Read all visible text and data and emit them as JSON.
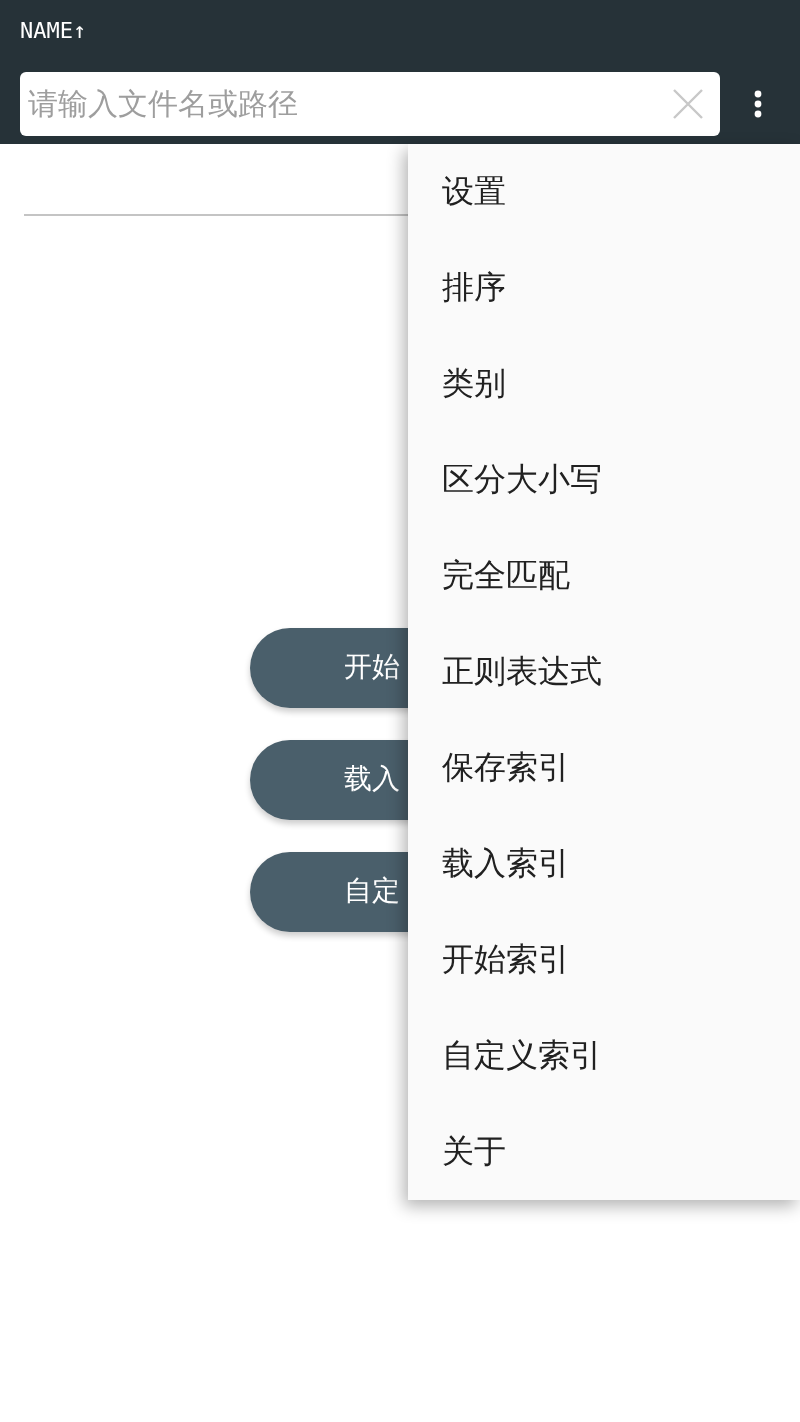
{
  "header": {
    "sort_label": "NAME↑",
    "search": {
      "placeholder": "请输入文件名或路径"
    }
  },
  "buttons": [
    "开始",
    "载入",
    "自定"
  ],
  "menu": {
    "items": [
      {
        "label": "设置"
      },
      {
        "label": "排序"
      },
      {
        "label": "类别"
      },
      {
        "label": "区分大小写"
      },
      {
        "label": "完全匹配"
      },
      {
        "label": "正则表达式"
      },
      {
        "label": "保存索引"
      },
      {
        "label": "载入索引"
      },
      {
        "label": "开始索引"
      },
      {
        "label": "自定义索引"
      },
      {
        "label": "关于"
      }
    ]
  }
}
